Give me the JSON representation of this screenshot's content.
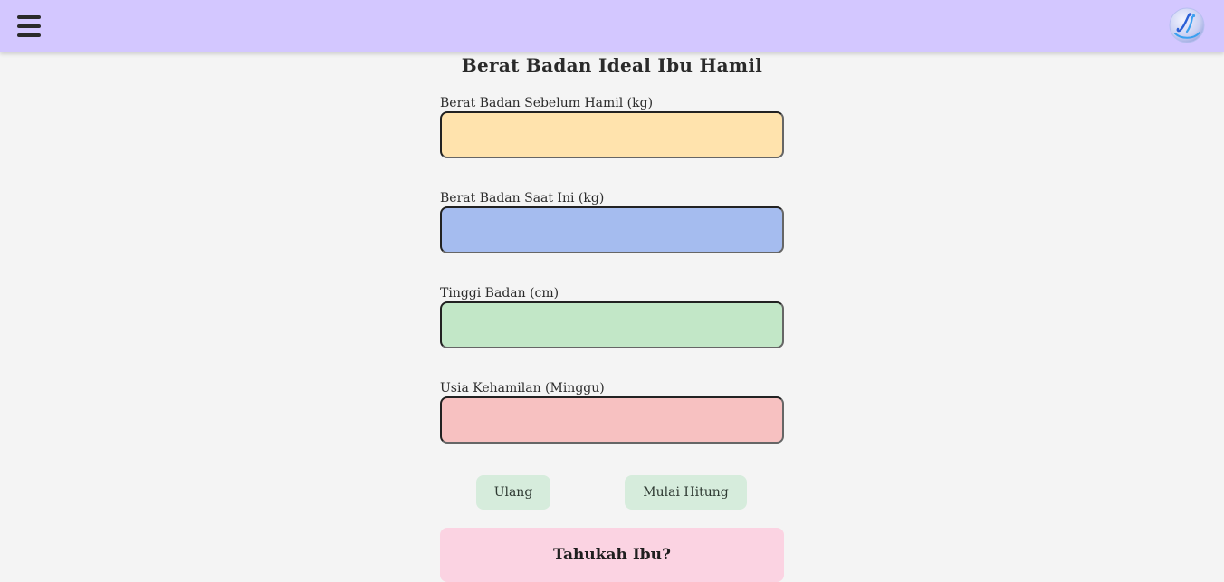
{
  "header": {
    "menu_icon": "hamburger-menu-icon",
    "logo_icon": "app-logo-icon",
    "accent_color": "#d3c7ff"
  },
  "page": {
    "title": "Berat Badan Ideal Ibu Hamil"
  },
  "form": {
    "fields": [
      {
        "label": "Berat Badan Sebelum Hamil (kg)",
        "value": "",
        "color": "#ffe3ad"
      },
      {
        "label": "Berat Badan Saat Ini (kg)",
        "value": "",
        "color": "#a5bcef"
      },
      {
        "label": "Tinggi Badan (cm)",
        "value": "",
        "color": "#c2e7c7"
      },
      {
        "label": "Usia Kehamilan (Minggu)",
        "value": "",
        "color": "#f7c1c1"
      }
    ],
    "reset_label": "Ulang",
    "submit_label": "Mulai Hitung"
  },
  "info": {
    "title": "Tahukah Ibu?"
  }
}
